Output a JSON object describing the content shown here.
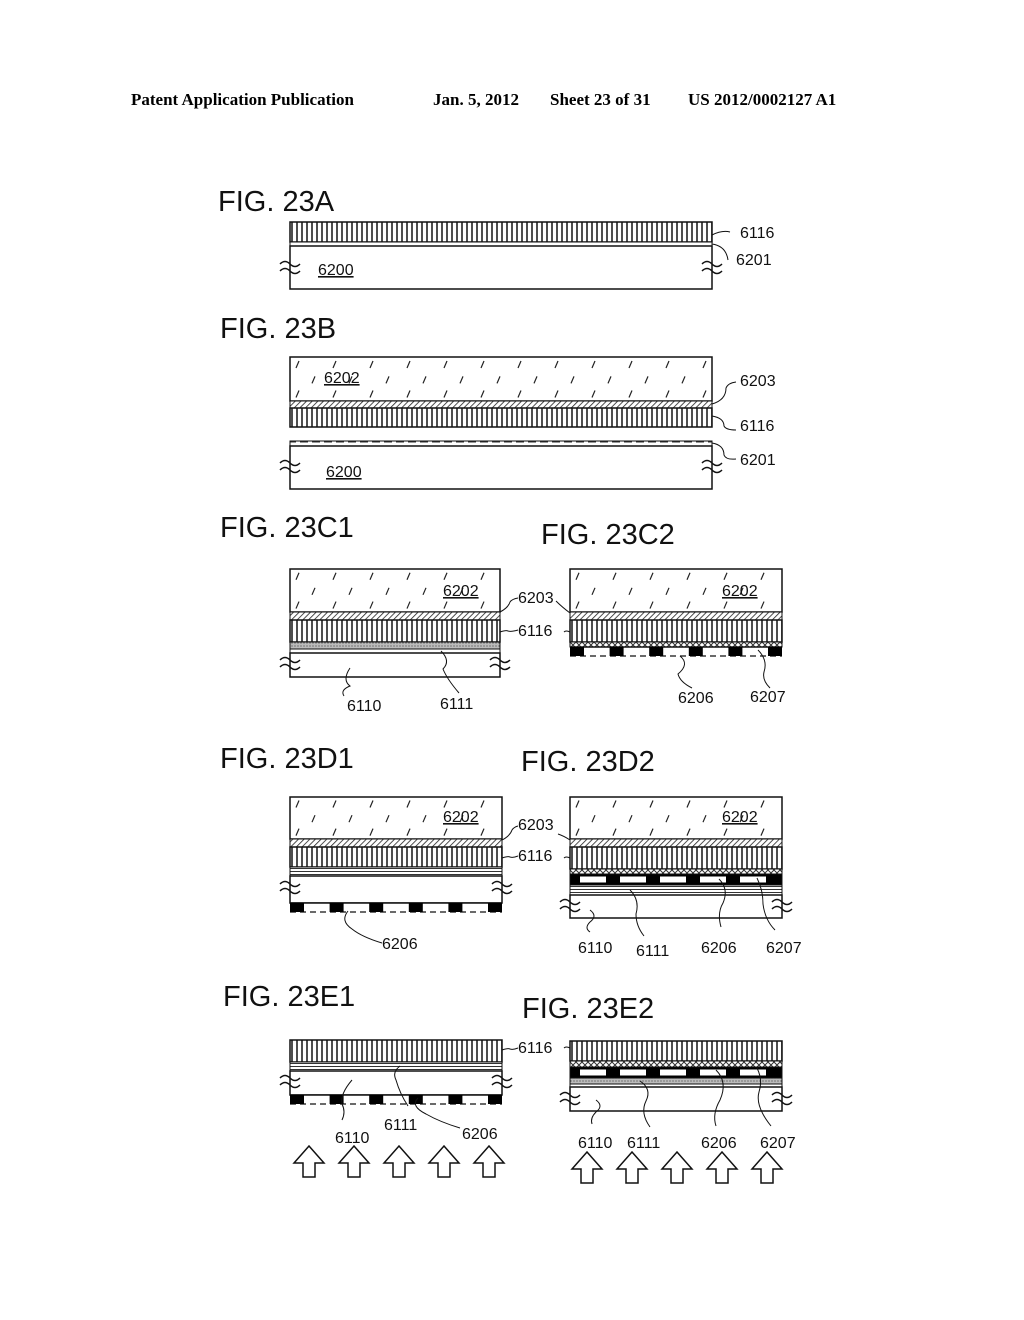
{
  "header": {
    "publication": "Patent Application Publication",
    "date": "Jan. 5, 2012",
    "sheet": "Sheet 23 of 31",
    "number": "US 2012/0002127 A1"
  },
  "figures": {
    "A": {
      "label": "FIG. 23A",
      "refs": {
        "r6116": "6116",
        "r6201": "6201",
        "r6200": "6200"
      }
    },
    "B": {
      "label": "FIG. 23B",
      "refs": {
        "r6202": "6202",
        "r6203": "6203",
        "r6116": "6116",
        "r6201": "6201",
        "r6200": "6200"
      }
    },
    "C1": {
      "label": "FIG. 23C1",
      "refs": {
        "r6202": "6202",
        "r6203": "6203",
        "r6116": "6116",
        "r6110": "6110",
        "r6111": "6111"
      }
    },
    "C2": {
      "label": "FIG. 23C2",
      "refs": {
        "r6202": "6202",
        "r6206": "6206",
        "r6207": "6207"
      }
    },
    "D1": {
      "label": "FIG. 23D1",
      "refs": {
        "r6202": "6202",
        "r6203": "6203",
        "r6116": "6116",
        "r6206": "6206"
      }
    },
    "D2": {
      "label": "FIG. 23D2",
      "refs": {
        "r6202": "6202",
        "r6110": "6110",
        "r6111": "6111",
        "r6206": "6206",
        "r6207": "6207"
      }
    },
    "E1": {
      "label": "FIG. 23E1",
      "refs": {
        "r6116": "6116",
        "r6110": "6110",
        "r6111": "6111",
        "r6206": "6206"
      },
      "arrow_count": 5
    },
    "E2": {
      "label": "FIG. 23E2",
      "refs": {
        "r6110": "6110",
        "r6111": "6111",
        "r6206": "6206",
        "r6207": "6207"
      },
      "arrow_count": 5
    }
  }
}
